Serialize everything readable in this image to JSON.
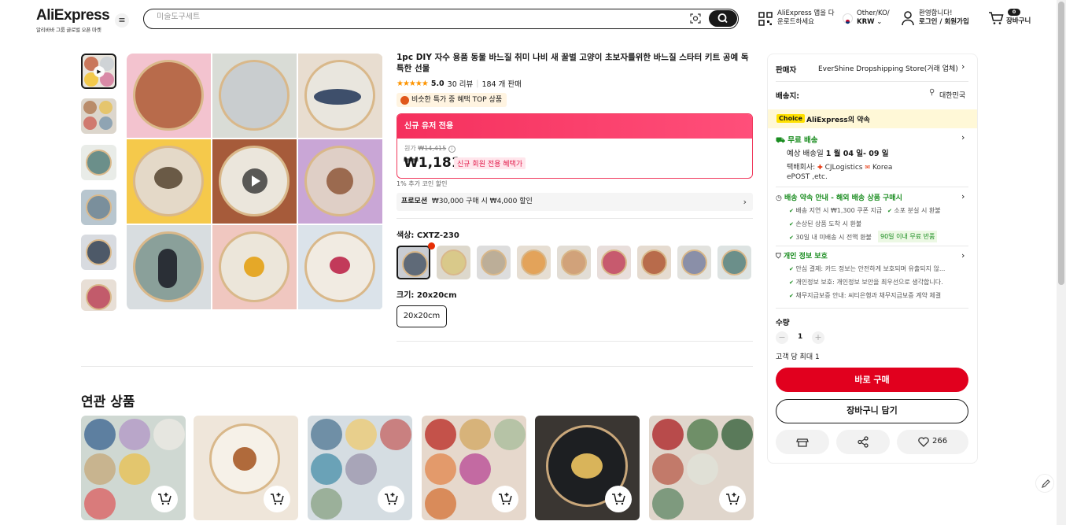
{
  "header": {
    "logo": "AliExpress",
    "logo_sub": "알리바바 그룹 글로벌 오픈 마켓",
    "search_placeholder": "미술도구세트",
    "app_line1": "AliExpress 앱을 다",
    "app_line2": "운로드하세요",
    "region_line1": "Other/KO/",
    "region_line2": "KRW",
    "user_line1": "환영합니다!",
    "user_line2": "로그인 / 회원가입",
    "cart_count": "0",
    "cart_label": "장바구니"
  },
  "product": {
    "title": "1pc DIY 자수 용품 동물 바느질 취미 나비 새 꿀벌 고양이 초보자를위한 바느질 스타터 키트 공예 독특한 선물",
    "rating": "5.0",
    "reviews": "30 리뷰",
    "sold": "184 개 판매",
    "top_tag": "비슷한 특가 중 혜택 TOP 상품",
    "new_user_label": "신규 유저 전용",
    "origin_label": "원가",
    "origin_price": "₩14,415",
    "price": "₩1,181",
    "new_member_tag": "신규 회원 전용 혜택가",
    "coin_note": "1% 추가 코인 할인",
    "promo_label": "프로모션",
    "promo_text": "₩30,000 구매 시 ₩4,000 할인",
    "color_label": "색상: CXTZ-230",
    "size_label": "크기: 20x20cm",
    "size_option": "20x20cm"
  },
  "related": {
    "title": "연관 상품"
  },
  "panel": {
    "seller_label": "판매자",
    "seller_name": "EverShine Dropshipping Store(거래 업체)",
    "ship_label": "배송지:",
    "ship_to": "대한민국",
    "choice_tag": "Choice",
    "promise": "AliExpress의 약속",
    "free_ship": "무료 배송",
    "eta_prefix": "예상 배송일",
    "eta": "1 월 04 일- 09 일",
    "courier_prefix": "택배회사:",
    "courier1": "CJLogistics",
    "courier2": "Korea",
    "courier3": "ePOST ,etc.",
    "delivery_title": "배송 약속 안내 - 해외 배송 상품 구매시",
    "delivery_item1": "배송 지연 시 ₩1,300 쿠폰 지급",
    "delivery_item2": "소포 분실 시 환불",
    "delivery_item3": "손상된 상품 도착 시 환불",
    "delivery_item4": "30일 내 미배송 시 전액 환불",
    "delivery_badge": "90일 이내 무료 반품",
    "privacy_title": "개인 정보 보호",
    "privacy_item1": "안심 결제: 카드 정보는 안전하게 보호되며 유출되지 않...",
    "privacy_item2": "개인정보 보호: 개인정보 보안을 최우선으로 생각합니다.",
    "privacy_item3": "채무지급보증 안내: 씨티은행과 채무지급보증 계약 체결",
    "qty_label": "수량",
    "qty_value": "1",
    "qty_limit": "고객 당 최대 1",
    "buy_now": "바로 구매",
    "add_cart": "장바구니 담기",
    "wish_count": "266"
  },
  "colors": {
    "brand_red": "#e1001e",
    "price_pink": "#f0385c",
    "green": "#198c1f"
  }
}
